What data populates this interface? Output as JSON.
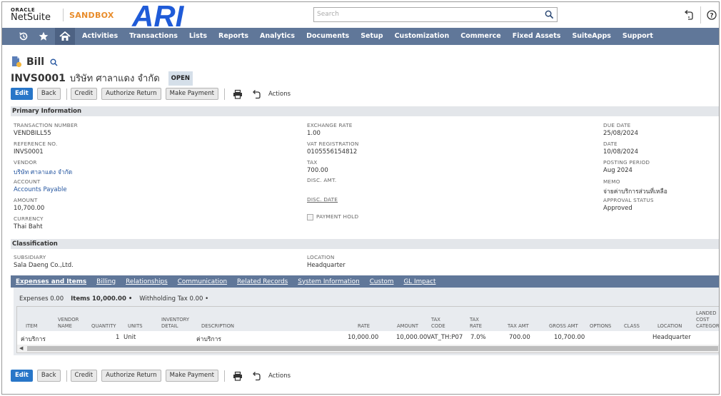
{
  "topbar": {
    "logo_oracle": "ORACLE",
    "logo_netsuite": "NetSuite",
    "environment": "SANDBOX",
    "brand_logo": "ARI",
    "search_placeholder": "Search"
  },
  "nav": {
    "icons": [
      "recent-icon",
      "star-icon",
      "home-icon"
    ],
    "items": [
      "Activities",
      "Transactions",
      "Lists",
      "Reports",
      "Analytics",
      "Documents",
      "Setup",
      "Customization",
      "Commerce",
      "Fixed Assets",
      "SuiteApps",
      "Support"
    ]
  },
  "record": {
    "type": "Bill",
    "number": "INVS0001",
    "vendor_name": "บริษัท ศาลาแดง จำกัด",
    "status": "OPEN"
  },
  "buttons": {
    "edit": "Edit",
    "back": "Back",
    "credit": "Credit",
    "authorize_return": "Authorize Return",
    "make_payment": "Make Payment",
    "actions": "Actions"
  },
  "primary": {
    "title": "Primary Information",
    "col1": [
      {
        "label": "TRANSACTION NUMBER",
        "value": "VENDBILL55",
        "link": false
      },
      {
        "label": "REFERENCE NO.",
        "value": "INVS0001",
        "link": false
      },
      {
        "label": "VENDOR",
        "value": "บริษัท ศาลาแดง จำกัด",
        "link": true
      },
      {
        "label": "ACCOUNT",
        "value": "Accounts Payable",
        "link": true
      },
      {
        "label": "AMOUNT",
        "value": "10,700.00",
        "link": false
      },
      {
        "label": "CURRENCY",
        "value": "Thai Baht",
        "link": false
      }
    ],
    "col2": [
      {
        "label": "EXCHANGE RATE",
        "value": "1.00"
      },
      {
        "label": "VAT REGISTRATION",
        "value": "0105556154812"
      },
      {
        "label": "TAX",
        "value": "700.00"
      },
      {
        "label": "DISC. AMT.",
        "value": ""
      },
      {
        "label": "DISC. DATE",
        "value": ""
      }
    ],
    "payment_hold_label": "PAYMENT HOLD",
    "col3": [
      {
        "label": "DUE DATE",
        "value": "25/08/2024"
      },
      {
        "label": "DATE",
        "value": "10/08/2024"
      },
      {
        "label": "POSTING PERIOD",
        "value": "Aug 2024"
      },
      {
        "label": "MEMO",
        "value": "จ่ายค่าบริการส่วนที่เหลือ"
      },
      {
        "label": "APPROVAL STATUS",
        "value": "Approved"
      }
    ]
  },
  "classification": {
    "title": "Classification",
    "subsidiary_label": "SUBSIDIARY",
    "subsidiary_value": "Sala Daeng Co.,Ltd.",
    "location_label": "LOCATION",
    "location_value": "Headquarter"
  },
  "tabs": [
    "Expenses and Items",
    "Billing",
    "Relationships",
    "Communication",
    "Related Records",
    "System Information",
    "Custom",
    "GL Impact"
  ],
  "subtabs": {
    "expenses": "Expenses 0.00",
    "items": "Items 10,000.00 •",
    "withholding": "Withholding Tax 0.00 •"
  },
  "grid": {
    "headers": {
      "item": "ITEM",
      "vendor_name": "VENDOR NAME",
      "quantity": "QUANTITY",
      "units": "UNITS",
      "inventory_detail": "INVENTORY DETAIL",
      "description": "DESCRIPTION",
      "rate": "RATE",
      "amount": "AMOUNT",
      "tax_code": "TAX CODE",
      "tax_rate": "TAX RATE",
      "tax_amt": "TAX AMT",
      "gross_amt": "GROSS AMT",
      "options": "OPTIONS",
      "class": "CLASS",
      "location": "LOCATION",
      "landed_cost": "LANDED COST CATEGORY"
    },
    "row": {
      "item": "ค่าบริการ",
      "vendor_name": "",
      "quantity": "1",
      "units": "Unit",
      "inventory_detail": "",
      "description": "ค่าบริการ",
      "rate": "10,000.00",
      "amount": "10,000.00",
      "tax_code": "VAT_TH:P07",
      "tax_rate": "7.0%",
      "tax_amt": "700.00",
      "gross_amt": "10,700.00",
      "options": "",
      "class": "",
      "location": "Headquarter",
      "landed_cost": ""
    }
  }
}
